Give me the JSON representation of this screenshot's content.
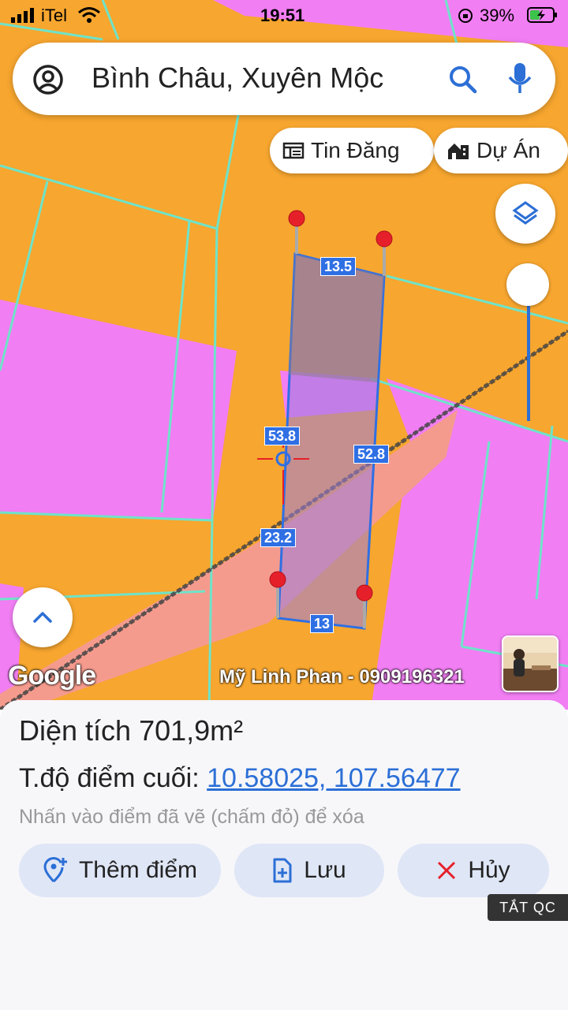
{
  "status_bar": {
    "carrier": "iTel",
    "time": "19:51",
    "battery": "39%"
  },
  "search": {
    "text": "Bình Châu, Xuyên Mộc"
  },
  "chips": {
    "listings_label": "Tin Đăng",
    "projects_label": "Dự Án"
  },
  "map": {
    "edge_labels": [
      "13.5",
      "52.8",
      "53.8",
      "23.2",
      "13"
    ],
    "watermark": "Mỹ Linh Phan - 0909196321",
    "logo": "Google",
    "colors": {
      "orange_zone": "#f7a62f",
      "pink_zone": "#f17ef3",
      "salmon_road": "#f59b8e",
      "parcel_lines": "#6fe3c9",
      "plot_outline": "#2f6fe4",
      "marker_red": "#e6202a"
    }
  },
  "info": {
    "area_label": "Diện tích",
    "area_value": "701,9m²",
    "last_point_label": "T.độ điểm cuối:",
    "last_point_coords": "10.58025, 107.56477",
    "hint": "Nhấn vào điểm đã vẽ (chấm đỏ) để xóa"
  },
  "actions": {
    "add_point": "Thêm điểm",
    "save": "Lưu",
    "cancel": "Hủy"
  },
  "ad_toggle": "TẮT QC"
}
